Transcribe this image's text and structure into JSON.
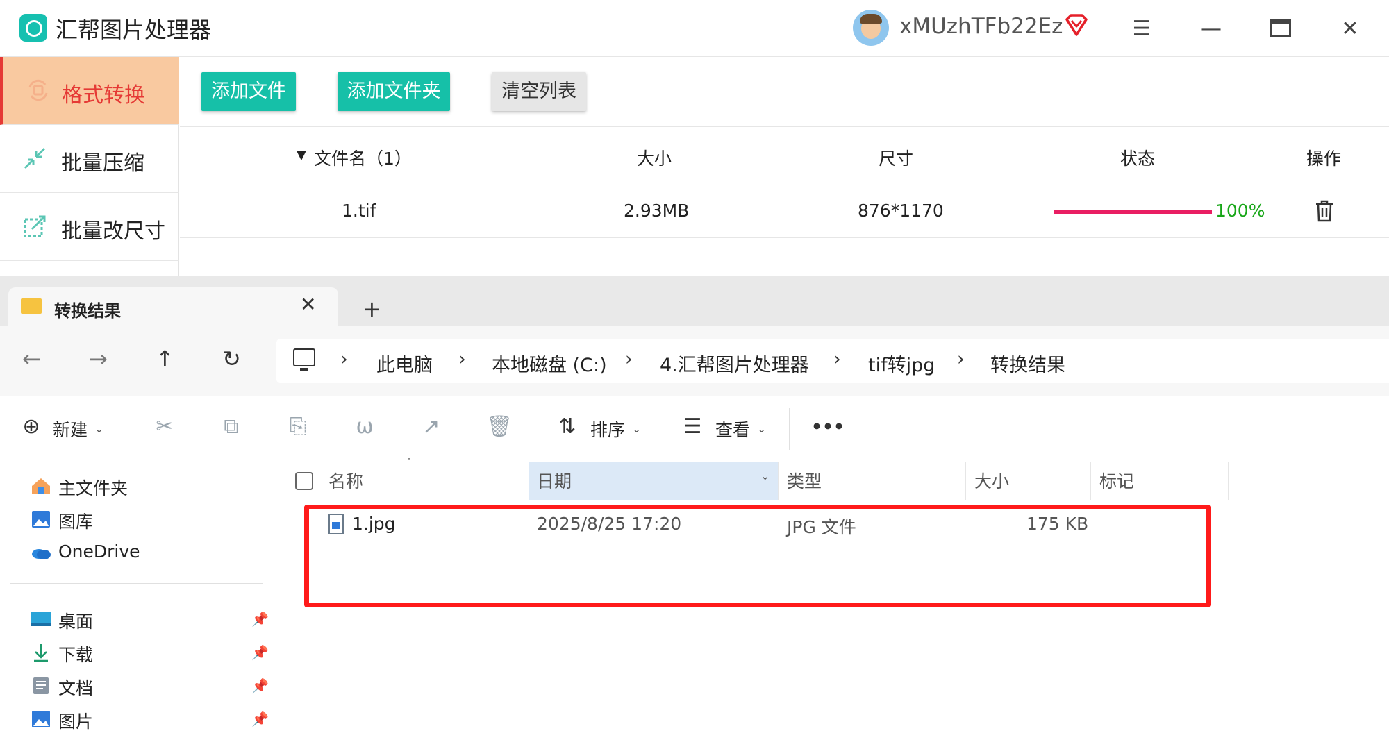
{
  "app": {
    "title": "汇帮图片处理器",
    "username": "xMUzhTFb22Ez",
    "sidebar": [
      {
        "label": "格式转换",
        "active": true,
        "icon": "format-convert-icon"
      },
      {
        "label": "批量压缩",
        "active": false,
        "icon": "compress-icon"
      },
      {
        "label": "批量改尺寸",
        "active": false,
        "icon": "resize-icon"
      }
    ],
    "toolbar": {
      "add_file": "添加文件",
      "add_folder": "添加文件夹",
      "clear_list": "清空列表"
    },
    "table": {
      "headers": [
        "文件名（1）",
        "大小",
        "尺寸",
        "状态",
        "操作"
      ],
      "rows": [
        {
          "name": "1.tif",
          "size": "2.93MB",
          "dimensions": "876*1170",
          "progress": 100,
          "progress_text": "100%"
        }
      ]
    },
    "colors": {
      "accent_teal": "#16c0a8",
      "active_bg": "#f9c9a0",
      "active_red": "#e53935",
      "progress": "#e91e63",
      "progress_text": "#17a617"
    }
  },
  "explorer": {
    "tab_title": "转换结果",
    "tab_new": "+",
    "breadcrumbs": [
      "此电脑",
      "本地磁盘 (C:)",
      "4.汇帮图片处理器",
      "tif转jpg",
      "转换结果"
    ],
    "commands": {
      "new": "新建",
      "sort": "排序",
      "view": "查看",
      "more": "•••"
    },
    "nav_pane": {
      "quick": [
        "主文件夹",
        "图库",
        "OneDrive"
      ],
      "pinned": [
        "桌面",
        "下载",
        "文档",
        "图片"
      ]
    },
    "columns": [
      "名称",
      "日期",
      "类型",
      "大小",
      "标记"
    ],
    "files": [
      {
        "name": "1.jpg",
        "date": "2025/8/25 17:20",
        "type": "JPG 文件",
        "size": "175 KB"
      }
    ],
    "highlight_color": "#ff1a1a"
  }
}
